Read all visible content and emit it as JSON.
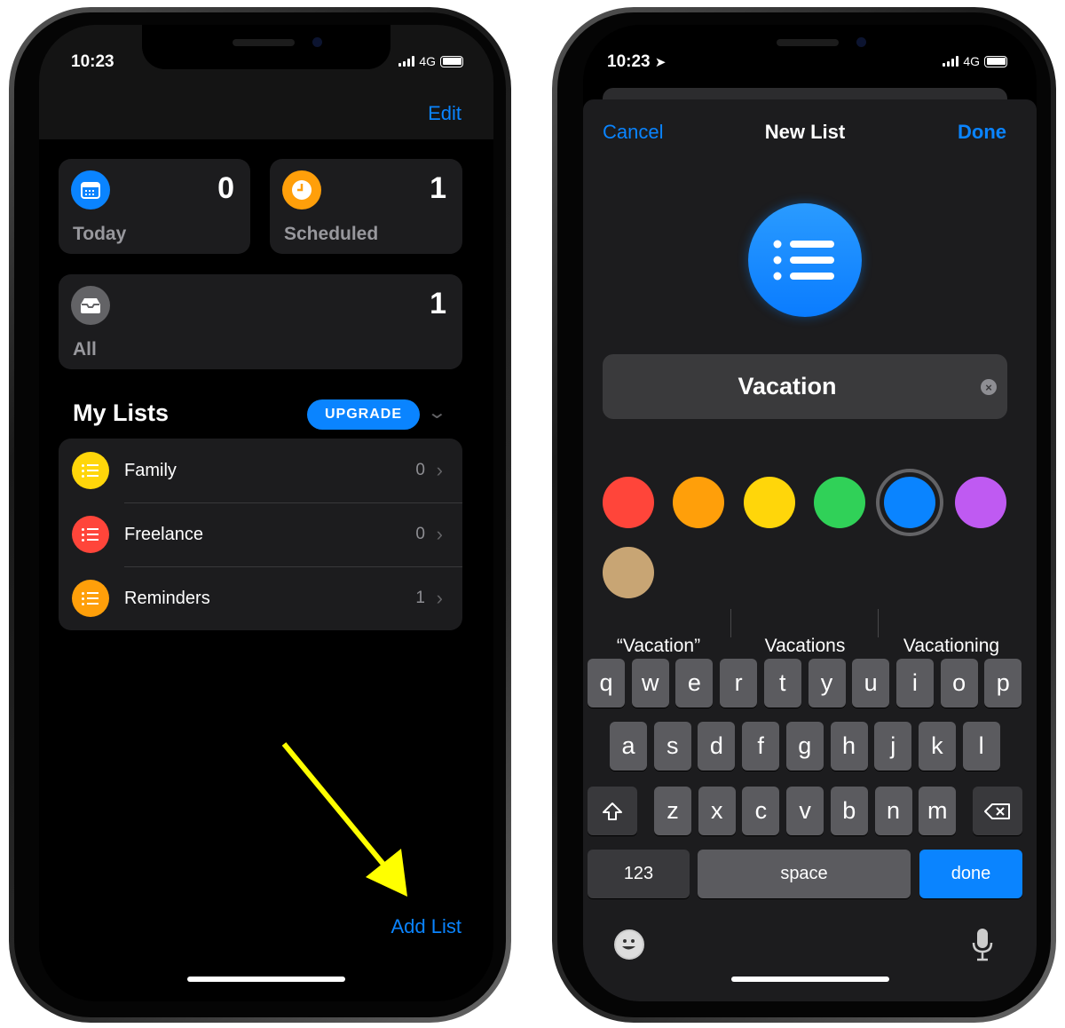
{
  "left": {
    "status": {
      "time": "10:23",
      "network": "4G"
    },
    "nav": {
      "edit": "Edit"
    },
    "smart": {
      "today": {
        "label": "Today",
        "count": "0",
        "icon": "calendar-icon",
        "color": "#0a84ff"
      },
      "scheduled": {
        "label": "Scheduled",
        "count": "1",
        "icon": "clock-icon",
        "color": "#ff9f0a"
      },
      "all": {
        "label": "All",
        "count": "1",
        "icon": "tray-icon",
        "color": "#636366"
      }
    },
    "my_lists": {
      "title": "My Lists",
      "upgrade": "UPGRADE",
      "items": [
        {
          "label": "Family",
          "count": "0",
          "color": "#ffd60a"
        },
        {
          "label": "Freelance",
          "count": "0",
          "color": "#ff453a"
        },
        {
          "label": "Reminders",
          "count": "1",
          "color": "#ff9f0a"
        }
      ]
    },
    "add_list": "Add List",
    "annotation_arrow_color": "#ffff00"
  },
  "right": {
    "status": {
      "time": "10:23",
      "network": "4G"
    },
    "sheet": {
      "cancel": "Cancel",
      "title": "New List",
      "done": "Done"
    },
    "name_field": {
      "value": "Vacation"
    },
    "colors": [
      "#ff453a",
      "#ff9f0a",
      "#ffd60a",
      "#30d158",
      "#0a84ff",
      "#bf5af2",
      "#c8a574"
    ],
    "selected_color": "#0a84ff",
    "suggestions": [
      "“Vacation”",
      "Vacations",
      "Vacationing"
    ],
    "keyboard": {
      "row1": [
        "q",
        "w",
        "e",
        "r",
        "t",
        "y",
        "u",
        "i",
        "o",
        "p"
      ],
      "row2": [
        "a",
        "s",
        "d",
        "f",
        "g",
        "h",
        "j",
        "k",
        "l"
      ],
      "row3": [
        "z",
        "x",
        "c",
        "v",
        "b",
        "n",
        "m"
      ],
      "numbers": "123",
      "space": "space",
      "done": "done"
    }
  }
}
